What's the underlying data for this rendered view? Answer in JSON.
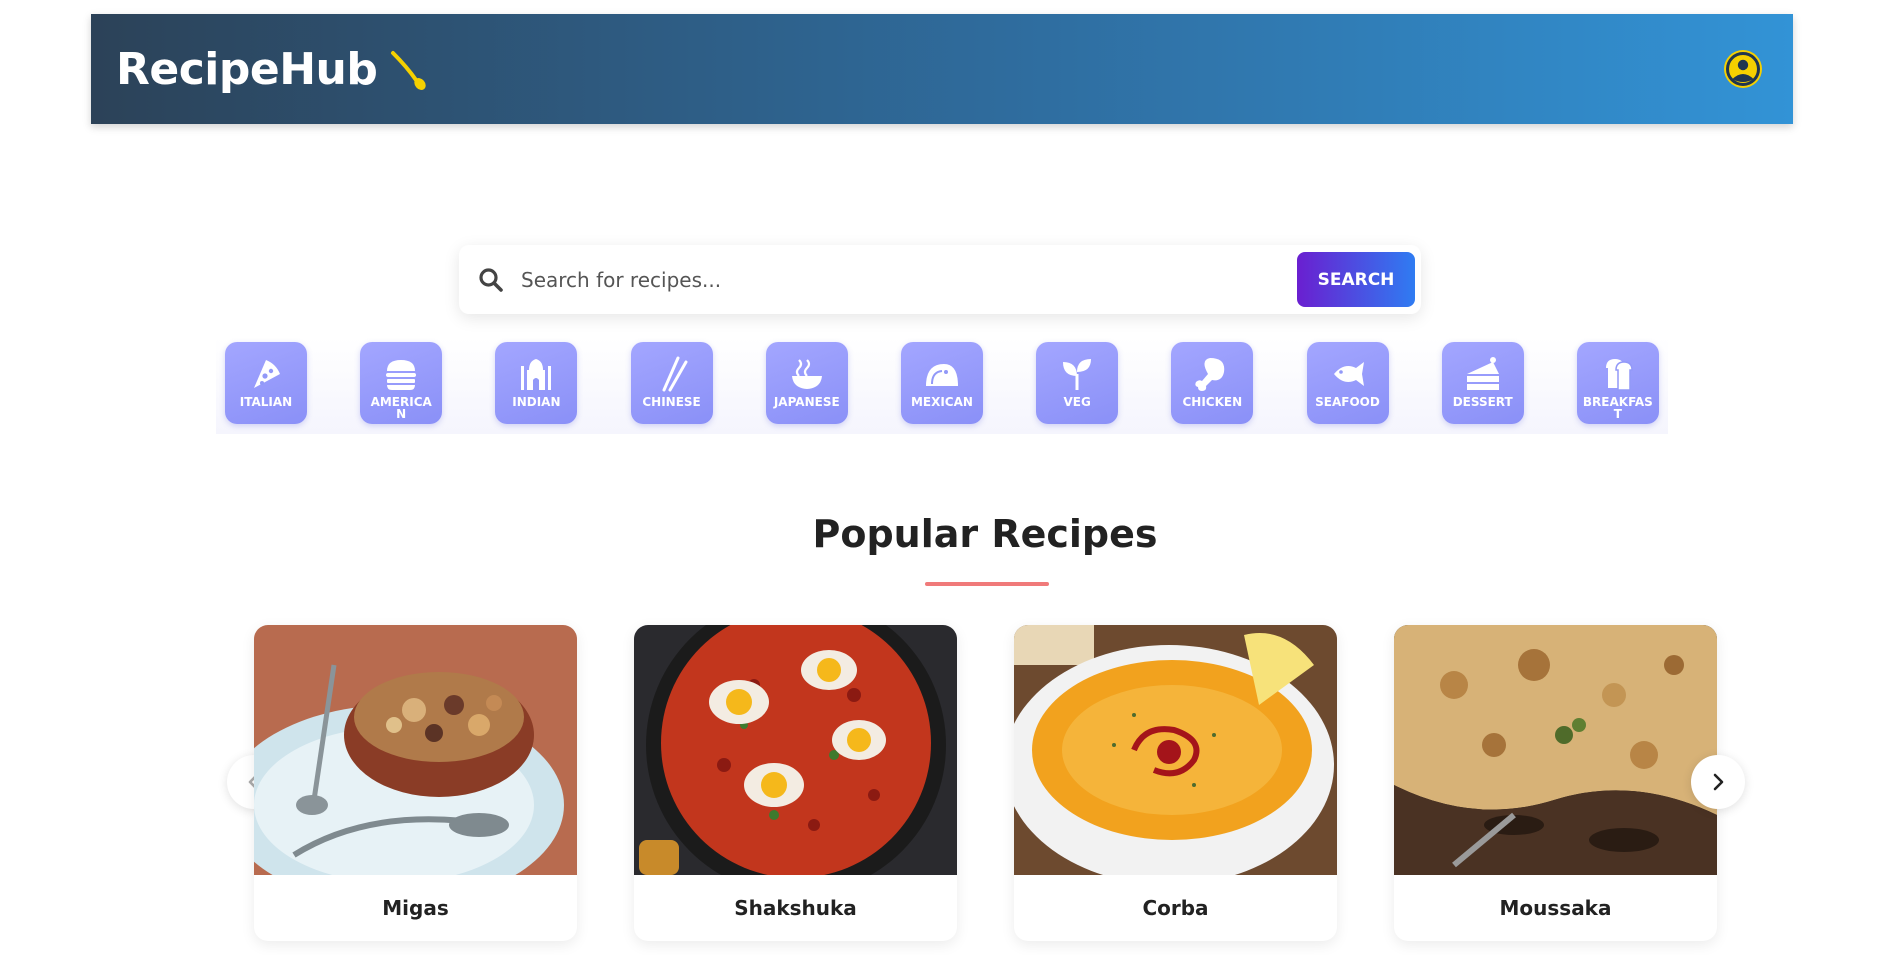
{
  "header": {
    "title": "RecipeHub",
    "brand_icon": "spoon-icon",
    "profile_icon": "user-circle-icon",
    "colors": {
      "gradient_start": "#2c4258",
      "gradient_end": "#3293d6",
      "accent": "#f5d000"
    }
  },
  "search": {
    "placeholder": "Search for recipes...",
    "value": "",
    "button_label": "SEARCH",
    "icon": "search-icon"
  },
  "categories": [
    {
      "label": "ITALIAN",
      "icon": "pizza-icon"
    },
    {
      "label": "AMERICAN",
      "icon": "burger-icon"
    },
    {
      "label": "INDIAN",
      "icon": "taj-mahal-icon"
    },
    {
      "label": "CHINESE",
      "icon": "chopsticks-icon"
    },
    {
      "label": "JAPANESE",
      "icon": "ramen-bowl-icon"
    },
    {
      "label": "MEXICAN",
      "icon": "taco-icon"
    },
    {
      "label": "VEG",
      "icon": "sprout-icon"
    },
    {
      "label": "CHICKEN",
      "icon": "drumstick-icon"
    },
    {
      "label": "SEAFOOD",
      "icon": "fish-icon"
    },
    {
      "label": "DESSERT",
      "icon": "cake-icon"
    },
    {
      "label": "BREAKFAST",
      "icon": "bread-icon"
    }
  ],
  "popular": {
    "title": "Popular Recipes",
    "recipes": [
      {
        "name": "Migas"
      },
      {
        "name": "Shakshuka"
      },
      {
        "name": "Corba"
      },
      {
        "name": "Moussaka"
      }
    ],
    "prev_icon": "chevron-left-icon",
    "next_icon": "chevron-right-icon"
  }
}
